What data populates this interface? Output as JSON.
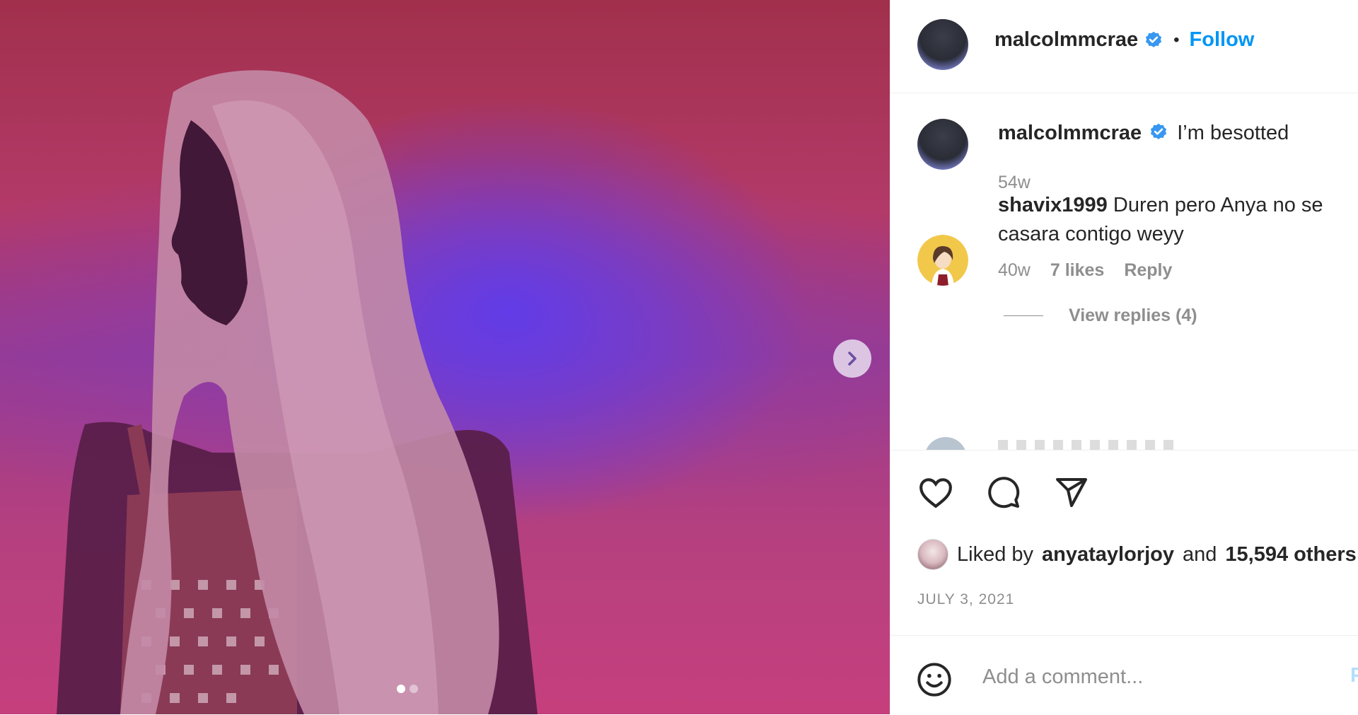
{
  "colors": {
    "accent": "#0095f6",
    "verified": "#3897f0",
    "secondary_text": "#8e8e8e",
    "primary_text": "#262626"
  },
  "media": {
    "carousel_total": 2,
    "carousel_active": 1,
    "next_icon": "chevron-right-icon"
  },
  "header": {
    "username": "malcolmmcrae",
    "separator": "•",
    "follow_label": "Follow"
  },
  "caption": {
    "username": "malcolmmcrae",
    "text": "I’m besotted",
    "time": "54w"
  },
  "comments": [
    {
      "username": "shavix1999",
      "text": "Duren pero Anya no se casara contigo weyy",
      "time": "40w",
      "likes": "7 likes",
      "reply_label": "Reply",
      "view_replies": "View replies (4)"
    }
  ],
  "actions": {
    "like_icon": "heart-icon",
    "comment_icon": "comment-bubble-icon",
    "share_icon": "paper-plane-icon"
  },
  "likes": {
    "prefix": "Liked by",
    "user": "anyataylorjoy",
    "joiner": "and",
    "count": "15,594 others"
  },
  "date": "JULY 3, 2021",
  "add_comment": {
    "placeholder": "Add a comment...",
    "post_label": "Post",
    "emoji_icon": "smiley-icon"
  }
}
